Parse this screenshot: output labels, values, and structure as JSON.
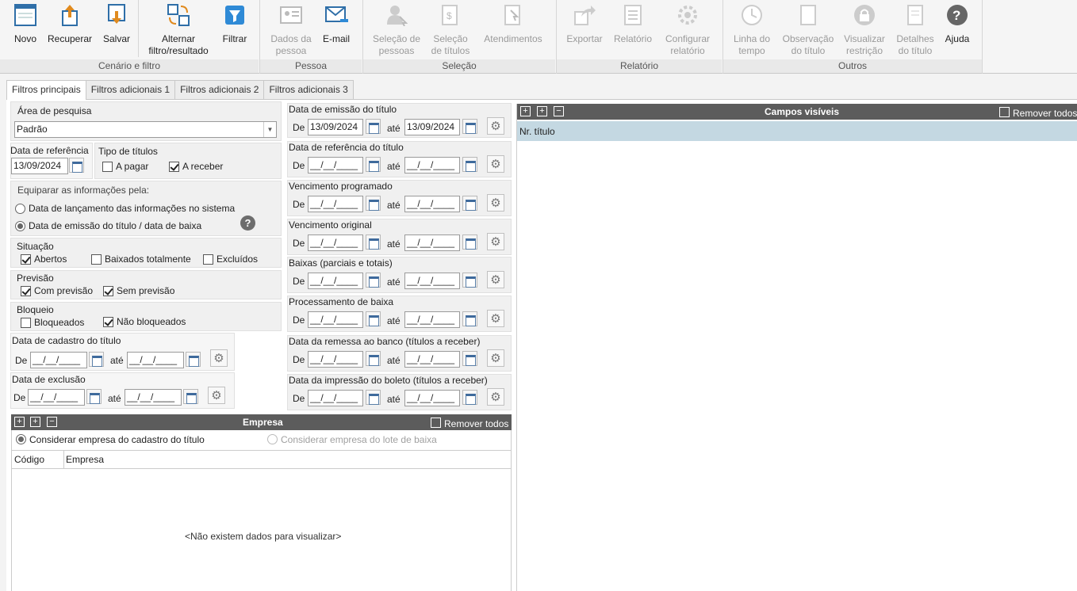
{
  "ribbon": {
    "novo": "Novo",
    "recuperar": "Recuperar",
    "salvar": "Salvar",
    "alternar": "Alternar filtro/resultado",
    "filtrar": "Filtrar",
    "dados_pessoa": "Dados da pessoa",
    "email": "E-mail",
    "selecao_pessoas": "Seleção de pessoas",
    "selecao_titulos": "Seleção de títulos",
    "atendimentos": "Atendimentos",
    "exportar": "Exportar",
    "relatorio": "Relatório",
    "configurar_relatorio": "Configurar relatório",
    "linha_tempo": "Linha do tempo",
    "observacao_titulo": "Observação do título",
    "visualizar_restricao": "Visualizar restrição",
    "detalhes_titulo": "Detalhes do título",
    "ajuda": "Ajuda",
    "groups": {
      "cenario": "Cenário e filtro",
      "pessoa": "Pessoa",
      "selecao": "Seleção",
      "relatorio": "Relatório",
      "outros": "Outros"
    }
  },
  "tabs": [
    "Filtros principais",
    "Filtros adicionais 1",
    "Filtros adicionais 2",
    "Filtros adicionais 3"
  ],
  "left": {
    "area_label": "Área de pesquisa",
    "area_value": "Padrão",
    "data_ref_label": "Data de referência",
    "data_ref_value": "13/09/2024",
    "tipo_label": "Tipo de títulos",
    "a_pagar": "A pagar",
    "a_receber": "A receber",
    "equiparar_label": "Equiparar as informações pela:",
    "opt_lancamento": "Data de lançamento das informações no sistema",
    "opt_emissao": "Data de emissão do título / data de baixa",
    "situacao_label": "Situação",
    "abertos": "Abertos",
    "baixados": "Baixados totalmente",
    "excluidos": "Excluídos",
    "previsao_label": "Previsão",
    "com_previsao": "Com previsão",
    "sem_previsao": "Sem previsão",
    "bloqueio_label": "Bloqueio",
    "bloqueados": "Bloqueados",
    "nao_bloqueados": "Não bloqueados",
    "cadastro_label": "Data de cadastro do título",
    "exclusao_label": "Data de exclusão",
    "de": "De",
    "ate": "até",
    "empty_date": "__/__/____"
  },
  "dates": [
    {
      "label": "Data de emissão do título",
      "from": "13/09/2024",
      "to": "13/09/2024"
    },
    {
      "label": "Data de referência do título",
      "from": "__/__/____",
      "to": "__/__/____"
    },
    {
      "label": "Vencimento programado",
      "from": "__/__/____",
      "to": "__/__/____"
    },
    {
      "label": "Vencimento original",
      "from": "__/__/____",
      "to": "__/__/____"
    },
    {
      "label": "Baixas (parciais e totais)",
      "from": "__/__/____",
      "to": "__/__/____"
    },
    {
      "label": "Processamento de baixa",
      "from": "__/__/____",
      "to": "__/__/____"
    },
    {
      "label": "Data da remessa ao banco (títulos a receber)",
      "from": "__/__/____",
      "to": "__/__/____"
    },
    {
      "label": "Data da impressão do boleto (títulos a receber)",
      "from": "__/__/____",
      "to": "__/__/____"
    }
  ],
  "empresa": {
    "title": "Empresa",
    "remover": "Remover todos",
    "opt_cadastro": "Considerar empresa do cadastro do título",
    "opt_lote": "Considerar empresa do lote de baixa",
    "col_codigo": "Código",
    "col_empresa": "Empresa",
    "empty": "<Não existem dados para visualizar>"
  },
  "campos": {
    "title": "Campos visíveis",
    "remover": "Remover todos",
    "row1": "Nr. título"
  }
}
